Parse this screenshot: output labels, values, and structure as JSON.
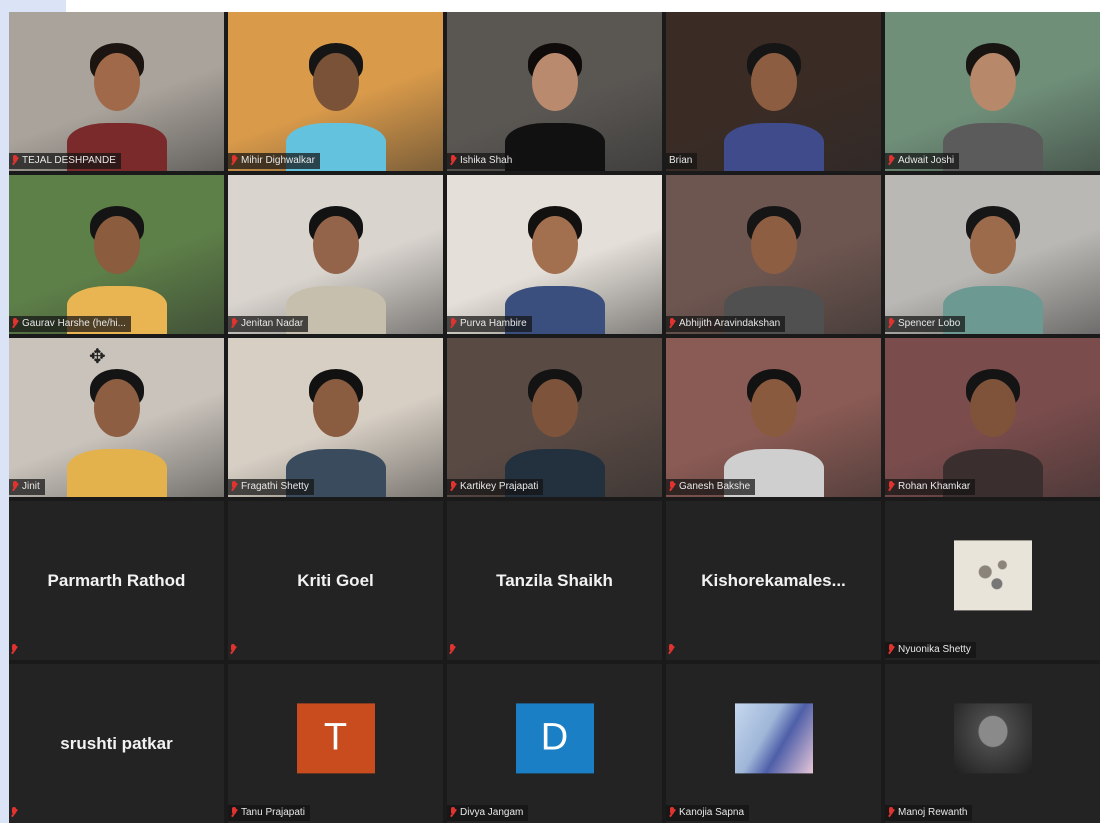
{
  "participants": [
    {
      "name": "TEJAL DESHPANDE",
      "type": "video",
      "bg": "#a9a39b",
      "skin": "#a06a4a",
      "shirt": "#7a2a2a",
      "hair": "#1b1411"
    },
    {
      "name": "Mihir Dighwalkar",
      "type": "video",
      "bg": "#d99a4a",
      "skin": "#7a5238",
      "shirt": "#63c3de",
      "hair": "#151515"
    },
    {
      "name": "Ishika Shah",
      "type": "video",
      "bg": "#5a5753",
      "skin": "#b98a6d",
      "shirt": "#111111",
      "hair": "#0e0b0a",
      "active": true
    },
    {
      "name": "Brian",
      "type": "video",
      "bg": "#3a2b25",
      "skin": "#8c5d40",
      "shirt": "#3f4b8a",
      "hair": "#151515"
    },
    {
      "name": "Adwait Joshi",
      "type": "video",
      "bg": "#6f8f79",
      "skin": "#b78869",
      "shirt": "#5b5b5b",
      "hair": "#181412"
    },
    {
      "name": "Gaurav Harshe (he/hi...",
      "type": "video",
      "bg": "#5d7f48",
      "skin": "#8b5c3d",
      "shirt": "#e8b552",
      "hair": "#141414"
    },
    {
      "name": "Jenitan Nadar",
      "type": "video",
      "bg": "#d9d4ce",
      "skin": "#94644a",
      "shirt": "#c7bfae",
      "hair": "#121212"
    },
    {
      "name": "Purva Hambire",
      "type": "video",
      "bg": "#e4dfd8",
      "skin": "#a3704f",
      "shirt": "#3a4f7d",
      "hair": "#131010"
    },
    {
      "name": "Abhijith Aravindakshan",
      "type": "video",
      "bg": "#6e5650",
      "skin": "#8e5e42",
      "shirt": "#505050",
      "hair": "#151515"
    },
    {
      "name": "Spencer Lobo",
      "type": "video",
      "bg": "#b9b8b4",
      "skin": "#9c6b4c",
      "shirt": "#6c9a93",
      "hair": "#161616"
    },
    {
      "name": "Jinit",
      "type": "video",
      "bg": "#c9c3bb",
      "skin": "#8d5e42",
      "shirt": "#e3b24c",
      "hair": "#141414",
      "move_icon": "move-cursor-icon"
    },
    {
      "name": "Fragathi Shetty",
      "type": "video",
      "bg": "#d7cfc4",
      "skin": "#8a5c40",
      "shirt": "#394b5c",
      "hair": "#111111"
    },
    {
      "name": "Kartikey Prajapati",
      "type": "video",
      "bg": "#5a4a44",
      "skin": "#7d543b",
      "shirt": "#23303e",
      "hair": "#131313"
    },
    {
      "name": "Ganesh Bakshe",
      "type": "video",
      "bg": "#8a5a54",
      "skin": "#8a5a3f",
      "shirt": "#cfcfcf",
      "hair": "#121212"
    },
    {
      "name": "Rohan Khamkar",
      "type": "video",
      "bg": "#7a4c4c",
      "skin": "#7f533a",
      "shirt": "#3a2e2e",
      "hair": "#141414"
    },
    {
      "name": "Parmarth Rathod",
      "type": "name_only"
    },
    {
      "name": "Kriti Goel",
      "type": "name_only"
    },
    {
      "name": "Tanzila Shaikh",
      "type": "name_only"
    },
    {
      "name": "Kishorekamales...",
      "type": "name_only"
    },
    {
      "name": "Nyuonika Shetty",
      "type": "picture",
      "pic": "sketch",
      "pic_color": "#e8e4da"
    },
    {
      "name": "srushti patkar",
      "type": "name_only"
    },
    {
      "name": "Tanu Prajapati",
      "type": "letter",
      "letter": "T",
      "color": "#c84c1e"
    },
    {
      "name": "Divya Jangam",
      "type": "letter",
      "letter": "D",
      "color": "#1a7fc4"
    },
    {
      "name": "Kanojia Sapna",
      "type": "picture",
      "pic": "anime",
      "pic_color": "#9fb6d8"
    },
    {
      "name": "Manoj Rewanth",
      "type": "picture",
      "pic": "dark",
      "pic_color": "#4a4a4a"
    }
  ],
  "icons": {
    "mic_muted": "mic-muted-icon"
  }
}
